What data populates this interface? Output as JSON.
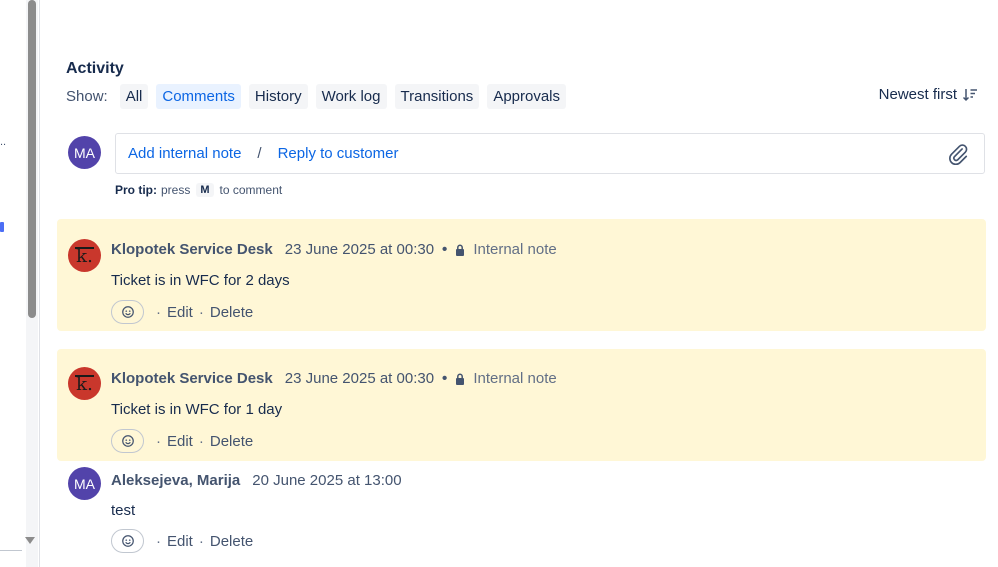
{
  "activity": {
    "title": "Activity",
    "show_label": "Show:",
    "filters": [
      {
        "label": "All",
        "active": false
      },
      {
        "label": "Comments",
        "active": true
      },
      {
        "label": "History",
        "active": false
      },
      {
        "label": "Work log",
        "active": false
      },
      {
        "label": "Transitions",
        "active": false
      },
      {
        "label": "Approvals",
        "active": false
      }
    ],
    "sort_label": "Newest first"
  },
  "composer": {
    "user_initials": "MA",
    "add_internal_note": "Add internal note",
    "separator": "/",
    "reply_to_customer": "Reply to customer",
    "pro_tip_label": "Pro tip:",
    "pro_tip_press": "press",
    "pro_tip_key": "M",
    "pro_tip_suffix": "to comment"
  },
  "comments": [
    {
      "author": "Klopotek Service Desk",
      "avatar_letter": "k.",
      "date": "23 June 2025 at 00:30",
      "visibility": "Internal note",
      "body": "Ticket is in WFC for 2 days",
      "edit": "Edit",
      "delete": "Delete"
    },
    {
      "author": "Klopotek Service Desk",
      "avatar_letter": "k.",
      "date": "23 June 2025 at 00:30",
      "visibility": "Internal note",
      "body": "Ticket is in WFC for 1 day",
      "edit": "Edit",
      "delete": "Delete"
    },
    {
      "author": "Aleksejeva, Marija",
      "avatar_initials": "MA",
      "date": "20 June 2025 at 13:00",
      "body": "test",
      "edit": "Edit",
      "delete": "Delete"
    }
  ],
  "left_panel": {
    "dots": ".."
  },
  "colors": {
    "accent": "#0c66e4",
    "internal_bg": "#fff7d6",
    "avatar_purple": "#5243aa",
    "brand_red": "#c9372c"
  }
}
